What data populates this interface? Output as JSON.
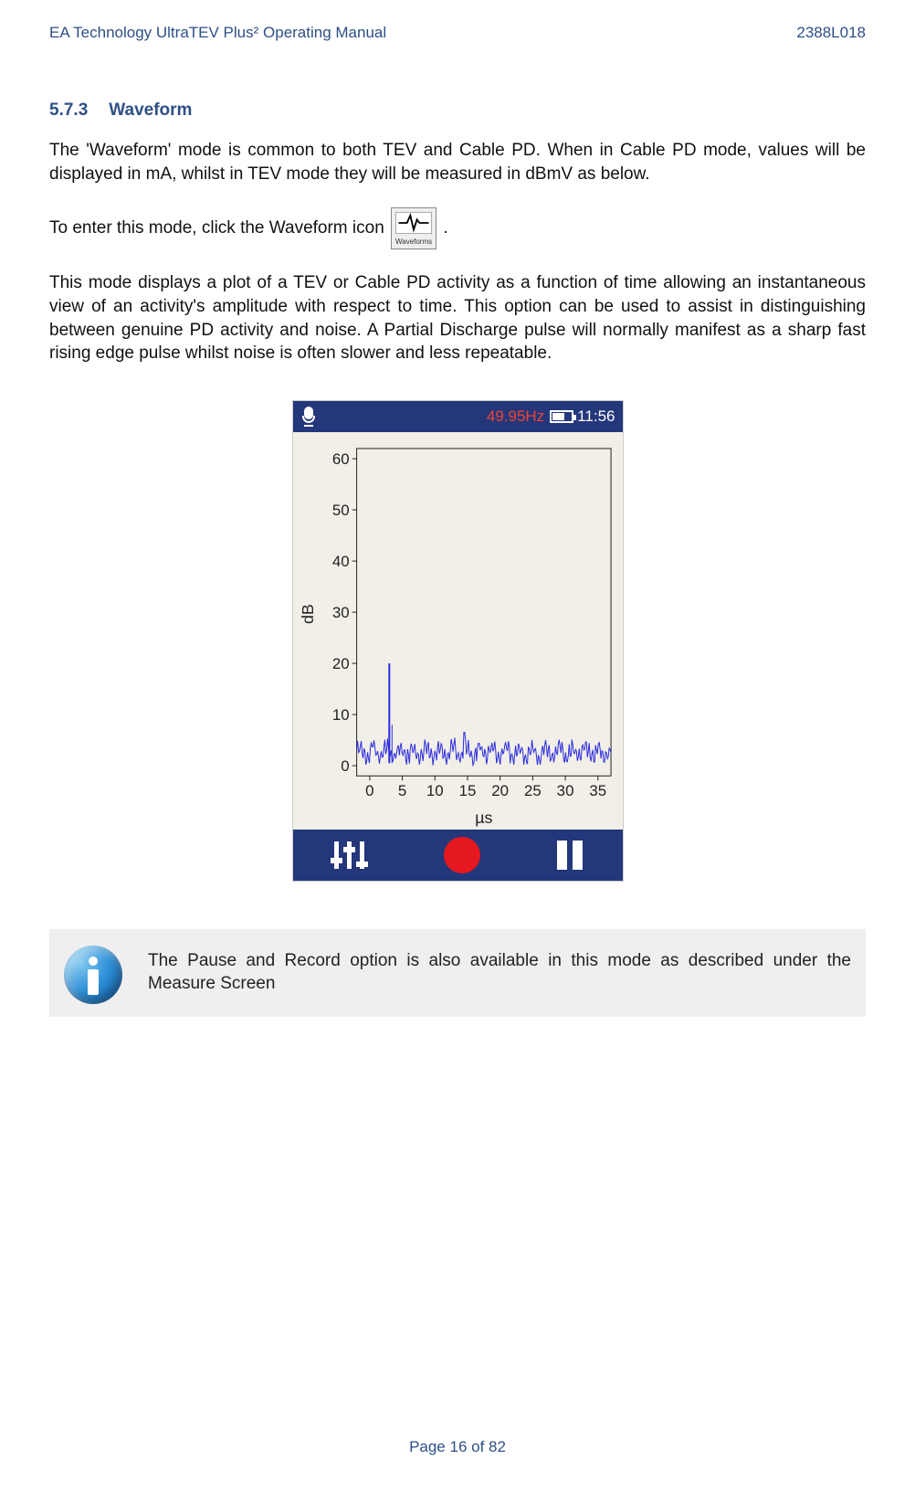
{
  "header": {
    "left": "EA Technology UltraTEV Plus² Operating Manual",
    "right": "2388L018"
  },
  "section": {
    "number": "5.7.3",
    "title": "Waveform"
  },
  "para1": "The 'Waveform' mode is common to both TEV and Cable PD. When in Cable PD mode, values will be displayed in mA, whilst in TEV mode they will be measured in dBmV as below.",
  "para2_pre": "To enter this mode, click the Waveform icon ",
  "para2_post": ".",
  "waveform_icon_label": "Waveforms",
  "para3": "This mode displays a plot of a TEV or Cable PD activity as a function of time allowing an instantaneous view of an activity's amplitude with respect to time. This option can be used to assist in distinguishing between genuine PD activity and noise. A Partial Discharge pulse will normally manifest as a sharp fast rising edge pulse whilst noise is often slower and less repeatable.",
  "device": {
    "frequency": "49.95Hz",
    "time": "11:56"
  },
  "chart_data": {
    "type": "line",
    "title": "",
    "xlabel": "µs",
    "ylabel": "dB",
    "xlim": [
      -2,
      37
    ],
    "ylim": [
      -2,
      62
    ],
    "xticks": [
      0,
      5,
      10,
      15,
      20,
      25,
      30,
      35
    ],
    "yticks": [
      0,
      10,
      20,
      30,
      40,
      50,
      60
    ],
    "series": [
      {
        "name": "noise-floor",
        "note": "baseline noise amplitude ~0-4 dB across full x range"
      },
      {
        "name": "pd-spike",
        "x": 3,
        "peak": 20
      }
    ]
  },
  "info_note": "The Pause and Record option is also available in this mode as described under the Measure Screen",
  "footer": "Page 16 of 82"
}
